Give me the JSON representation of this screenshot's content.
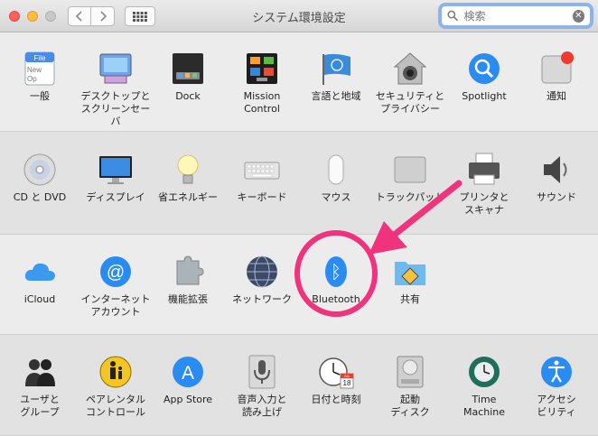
{
  "window": {
    "title": "システム環境設定"
  },
  "search": {
    "placeholder": "検索",
    "clear_glyph": "✕"
  },
  "rows": [
    [
      {
        "name": "general",
        "label": "一般"
      },
      {
        "name": "desktop-screensaver",
        "label": "デスクトップと\nスクリーンセーバ"
      },
      {
        "name": "dock",
        "label": "Dock"
      },
      {
        "name": "mission-control",
        "label": "Mission\nControl"
      },
      {
        "name": "language-region",
        "label": "言語と地域"
      },
      {
        "name": "security-privacy",
        "label": "セキュリティと\nプライバシー"
      },
      {
        "name": "spotlight",
        "label": "Spotlight"
      },
      {
        "name": "notifications",
        "label": "通知"
      }
    ],
    [
      {
        "name": "cd-dvd",
        "label": "CD と DVD"
      },
      {
        "name": "displays",
        "label": "ディスプレイ"
      },
      {
        "name": "energy-saver",
        "label": "省エネルギー"
      },
      {
        "name": "keyboard",
        "label": "キーボード"
      },
      {
        "name": "mouse",
        "label": "マウス"
      },
      {
        "name": "trackpad",
        "label": "トラックパッド"
      },
      {
        "name": "printers-scanners",
        "label": "プリンタと\nスキャナ"
      },
      {
        "name": "sound",
        "label": "サウンド"
      }
    ],
    [
      {
        "name": "icloud",
        "label": "iCloud"
      },
      {
        "name": "internet-accounts",
        "label": "インターネット\nアカウント"
      },
      {
        "name": "extensions",
        "label": "機能拡張"
      },
      {
        "name": "network",
        "label": "ネットワーク"
      },
      {
        "name": "bluetooth",
        "label": "Bluetooth"
      },
      {
        "name": "sharing",
        "label": "共有"
      }
    ],
    [
      {
        "name": "users-groups",
        "label": "ユーザと\nグループ"
      },
      {
        "name": "parental-controls",
        "label": "ペアレンタル\nコントロール"
      },
      {
        "name": "app-store",
        "label": "App Store"
      },
      {
        "name": "dictation-speech",
        "label": "音声入力と\n読み上げ"
      },
      {
        "name": "date-time",
        "label": "日付と時刻"
      },
      {
        "name": "startup-disk",
        "label": "起動\nディスク"
      },
      {
        "name": "time-machine",
        "label": "Time\nMachine"
      },
      {
        "name": "accessibility",
        "label": "アクセシ\nビリティ"
      }
    ]
  ],
  "icon_text": {
    "general_file": "File",
    "general_new": "New",
    "general_op": "Op",
    "calendar_month": "JUL",
    "calendar_day": "18",
    "app_store_glyph": "A",
    "at_glyph": "@",
    "bluetooth_glyph": "ᛒ"
  },
  "colors": {
    "highlight": "#f0337c",
    "selection": "#1a82fb"
  }
}
